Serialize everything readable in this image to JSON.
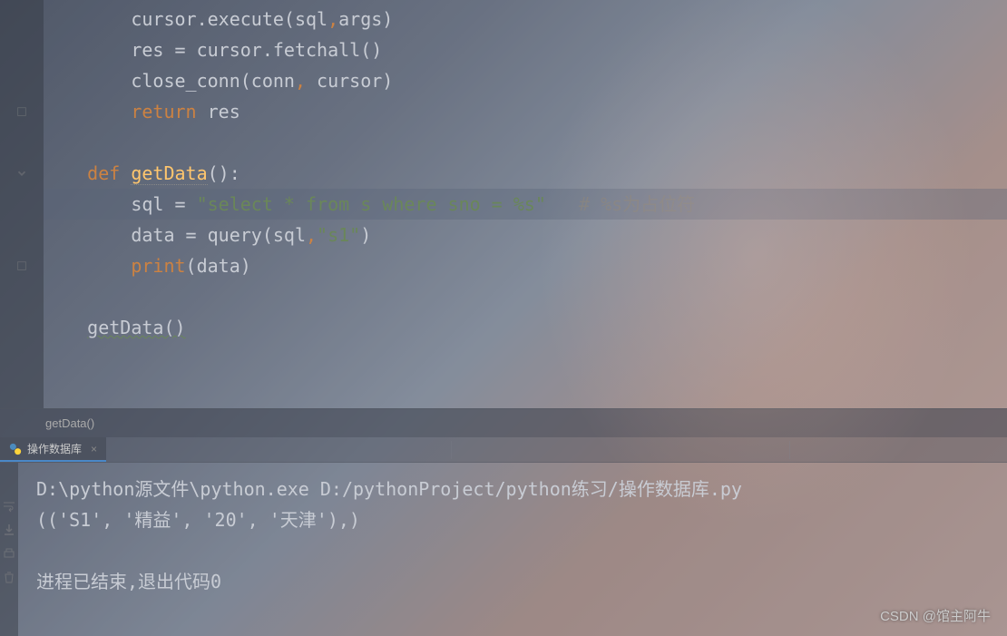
{
  "code": {
    "lines": [
      {
        "indent": "        ",
        "tokens": [
          {
            "t": "cursor.execute(sql",
            "c": ""
          },
          {
            "t": ",",
            "c": "comma"
          },
          {
            "t": "args)",
            "c": ""
          }
        ]
      },
      {
        "indent": "        ",
        "tokens": [
          {
            "t": "res = cursor.fetchall()",
            "c": ""
          }
        ]
      },
      {
        "indent": "        ",
        "tokens": [
          {
            "t": "close_conn(conn",
            "c": ""
          },
          {
            "t": ", ",
            "c": "comma"
          },
          {
            "t": "cursor)",
            "c": ""
          }
        ]
      },
      {
        "indent": "        ",
        "tokens": [
          {
            "t": "return ",
            "c": "kw"
          },
          {
            "t": "res",
            "c": ""
          }
        ]
      },
      {
        "indent": "",
        "tokens": []
      },
      {
        "indent": "    ",
        "tokens": [
          {
            "t": "def ",
            "c": "kw"
          },
          {
            "t": "getData",
            "c": "fn def-underline"
          },
          {
            "t": "():",
            "c": ""
          }
        ]
      },
      {
        "indent": "        ",
        "hl": true,
        "tokens": [
          {
            "t": "sql = ",
            "c": ""
          },
          {
            "t": "\"select * from s where sno = %s\"",
            "c": "str"
          },
          {
            "t": "   ",
            "c": ""
          },
          {
            "t": "# %s为占位符",
            "c": "comment"
          }
        ]
      },
      {
        "indent": "        ",
        "tokens": [
          {
            "t": "data = query(sql",
            "c": ""
          },
          {
            "t": ",",
            "c": "comma"
          },
          {
            "t": "\"s1\"",
            "c": "str"
          },
          {
            "t": ")",
            "c": ""
          }
        ]
      },
      {
        "indent": "        ",
        "tokens": [
          {
            "t": "print",
            "c": "kw"
          },
          {
            "t": "(data)",
            "c": ""
          }
        ]
      },
      {
        "indent": "",
        "tokens": []
      },
      {
        "indent": "    ",
        "tokens": [
          {
            "t": "getData",
            "c": "underline"
          },
          {
            "t": "()",
            "c": "underline"
          }
        ]
      },
      {
        "indent": "",
        "tokens": []
      },
      {
        "indent": "",
        "tokens": []
      }
    ]
  },
  "breadcrumb": {
    "text": "getData()"
  },
  "tab": {
    "label": "操作数据库"
  },
  "console": {
    "line1": "D:\\python源文件\\python.exe D:/pythonProject/python练习/操作数据库.py",
    "line2": "(('S1', '精益', '20', '天津'),)",
    "line3": "",
    "line4": "进程已结束,退出代码0"
  },
  "watermark": "CSDN @馆主阿牛"
}
